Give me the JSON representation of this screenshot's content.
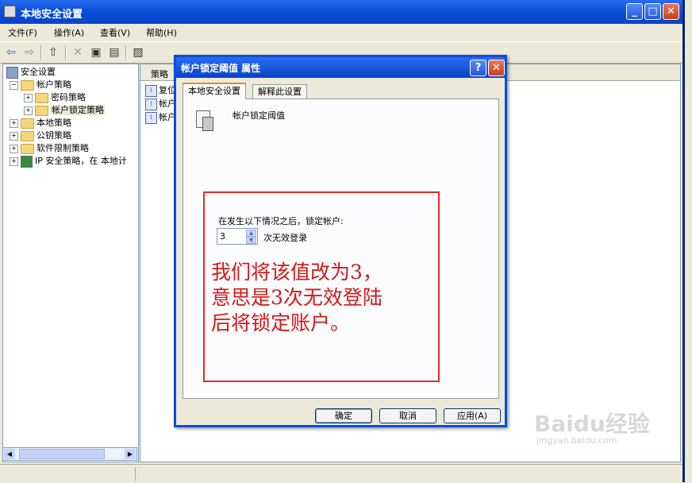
{
  "window": {
    "title": "本地安全设置"
  },
  "menu": [
    "文件(F)",
    "操作(A)",
    "查看(V)",
    "帮助(H)"
  ],
  "tree": [
    {
      "label": "安全设置",
      "indent": 0,
      "expander": "",
      "icon": "security-settings-icon"
    },
    {
      "label": "帐户策略",
      "indent": 1,
      "expander": "−",
      "icon": "folder-open-icon"
    },
    {
      "label": "密码策略",
      "indent": 2,
      "expander": "+",
      "icon": "folder-icon"
    },
    {
      "label": "帐户锁定策略",
      "indent": 2,
      "expander": "+",
      "icon": "folder-open-icon",
      "selected": true
    },
    {
      "label": "本地策略",
      "indent": 1,
      "expander": "+",
      "icon": "folder-icon"
    },
    {
      "label": "公钥策略",
      "indent": 1,
      "expander": "+",
      "icon": "folder-icon"
    },
    {
      "label": "软件限制策略",
      "indent": 1,
      "expander": "+",
      "icon": "folder-icon"
    },
    {
      "label": "IP 安全策略，在 本地计",
      "indent": 1,
      "expander": "+",
      "icon": "ip-security-icon"
    }
  ],
  "list": {
    "column_header": "策略",
    "items": [
      "复位",
      "帐户",
      "帐户"
    ]
  },
  "dialog": {
    "title": "帐户锁定阈值 属性",
    "tabs": [
      "本地安全设置",
      "解释此设置"
    ],
    "policy_name": "帐户锁定阈值",
    "prompt": "在发生以下情况之后，锁定帐户:",
    "spin_value": "3",
    "spin_suffix": "次无效登录",
    "annotation": "我们将该值改为3，\n意思是3次无效登陆\n后将锁定账户。",
    "buttons": {
      "ok": "确定",
      "cancel": "取消",
      "apply": "应用(A)"
    },
    "help_glyph": "?",
    "close_glyph": "✕"
  },
  "watermark": {
    "brand": "Baidu经验",
    "url": "jingyan.baidu.com"
  },
  "colors": {
    "titlebar": "#0843c6",
    "annotation": "#e32a2a",
    "xp_face": "#ece9d8"
  }
}
